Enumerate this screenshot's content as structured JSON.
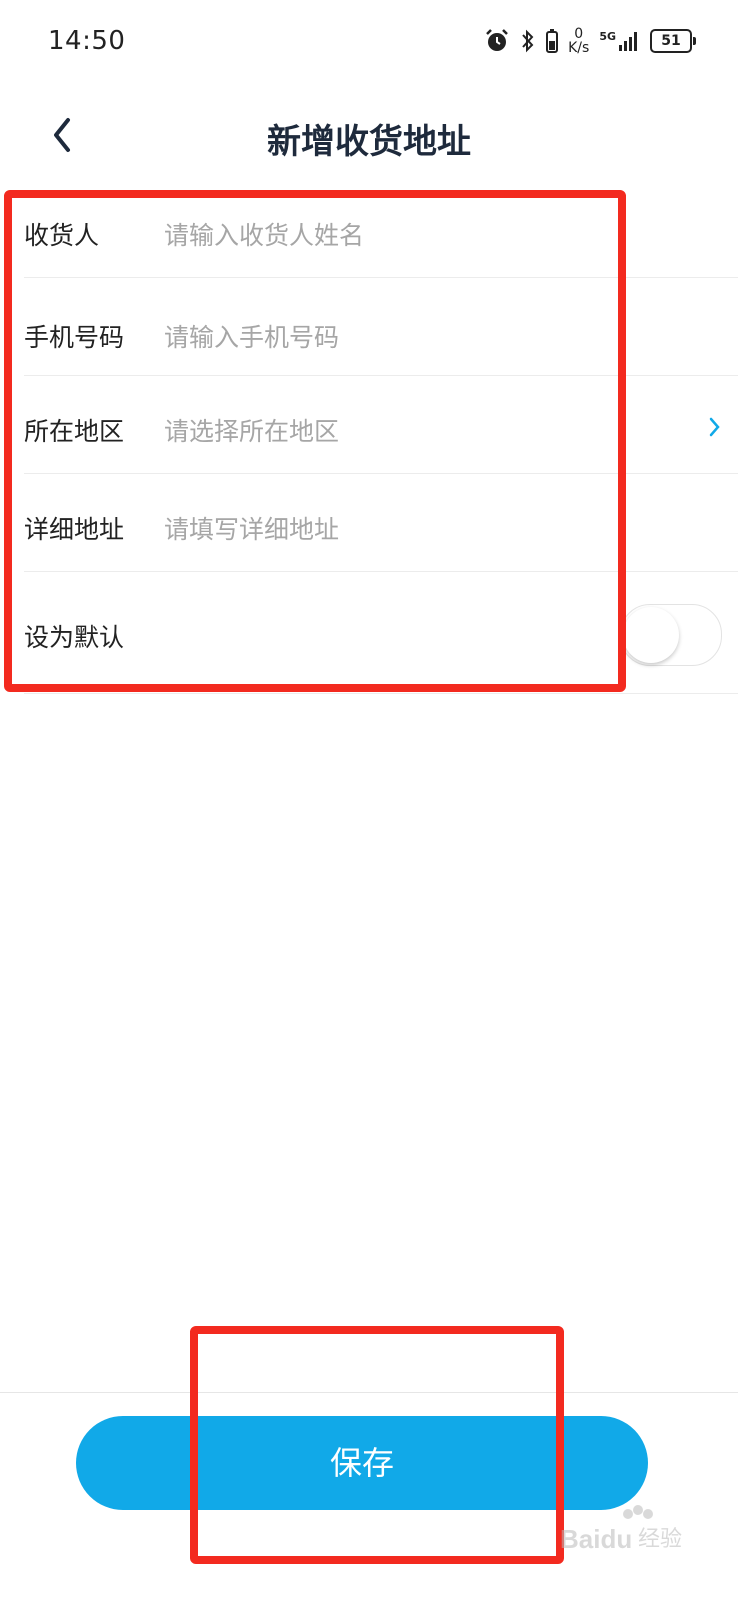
{
  "status_bar": {
    "time": "14:50",
    "net_speed_value": "0",
    "net_speed_unit": "K/s",
    "network_type": "5G",
    "battery": "51"
  },
  "nav": {
    "title": "新增收货地址"
  },
  "form": {
    "rows": [
      {
        "label": "收货人",
        "placeholder": "请输入收货人姓名"
      },
      {
        "label": "手机号码",
        "placeholder": "请输入手机号码"
      },
      {
        "label": "所在地区",
        "placeholder": "请选择所在地区"
      },
      {
        "label": "详细地址",
        "placeholder": "请填写详细地址"
      },
      {
        "label": "设为默认",
        "toggle_on": false
      }
    ]
  },
  "save_button": {
    "label": "保存"
  },
  "watermark": {
    "text": "Baidu经验"
  },
  "colors": {
    "accent": "#11a9e8",
    "highlight": "#f32a1f",
    "title": "#1e2a3c"
  }
}
